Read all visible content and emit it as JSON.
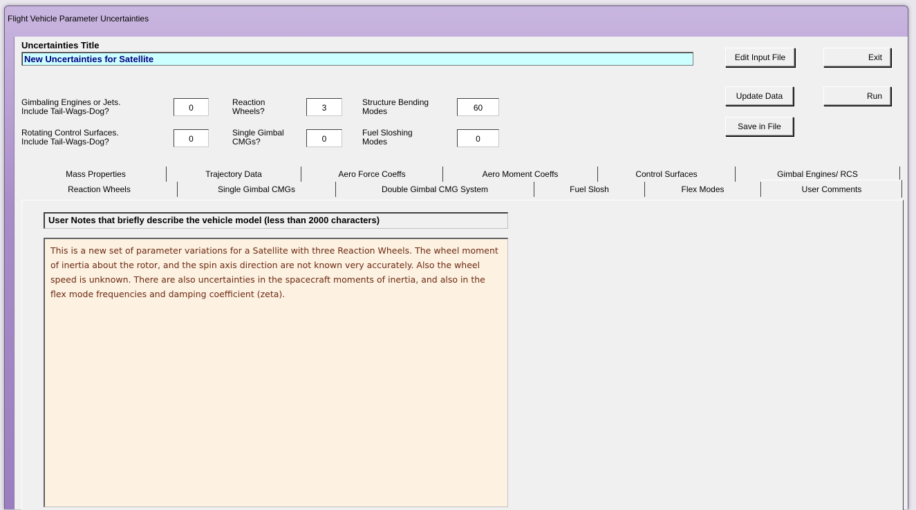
{
  "window": {
    "title": "Flight Vehicle Parameter Uncertainties"
  },
  "uncertainties": {
    "label": "Uncertainties Title",
    "value": "New Uncertainties for Satellite"
  },
  "buttons": {
    "edit_input_file": "Edit Input File",
    "exit": "Exit",
    "update_data": "Update Data",
    "run": "Run",
    "save_in_file": "Save in File"
  },
  "params": {
    "gimbaling_engines": {
      "label1": "Gimbaling Engines or Jets.",
      "label2": "Include Tail-Wags-Dog?",
      "value": "0"
    },
    "reaction_wheels": {
      "label1": "Reaction",
      "label2": "Wheels?",
      "value": "3"
    },
    "structure_bending": {
      "label1": "Structure Bending",
      "label2": "Modes",
      "value": "60"
    },
    "rotating_surfaces": {
      "label1": "Rotating Control Surfaces.",
      "label2": "Include Tail-Wags-Dog?",
      "value": "0"
    },
    "single_gimbal": {
      "label1": "Single Gimbal",
      "label2": "CMGs?",
      "value": "0"
    },
    "fuel_sloshing": {
      "label1": "Fuel Sloshing",
      "label2": "Modes",
      "value": "0"
    }
  },
  "tabs_row1": [
    "Mass Properties",
    "Trajectory Data",
    "Aero Force Coeffs",
    "Aero Moment Coeffs",
    "Control Surfaces",
    "Gimbal Engines/ RCS"
  ],
  "tabs_row2": [
    "Reaction Wheels",
    "Single Gimbal CMGs",
    "Double Gimbal CMG System",
    "Fuel Slosh",
    "Flex Modes",
    "User Comments"
  ],
  "notes": {
    "header": "User Notes that briefly describe the vehicle model (less than 2000 characters)",
    "text": "This is a new set of parameter variations for a Satellite with three Reaction Wheels. The wheel  moment of inertia about the rotor, and the spin axis direction are not known very accurately.  Also the wheel speed is unknown. There are also uncertainties in the spacecraft moments of  inertia, and also in the flex mode frequencies and damping coefficient (zeta)."
  }
}
